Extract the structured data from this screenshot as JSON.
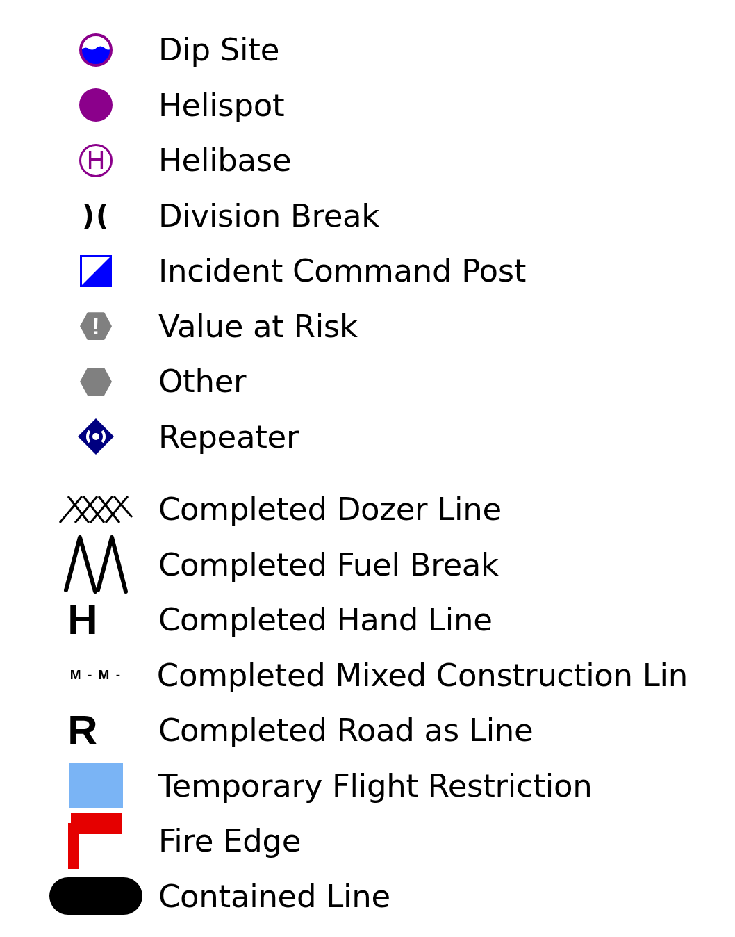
{
  "legend": {
    "groups": [
      {
        "items": [
          {
            "kind": "dip-site",
            "label": "Dip Site"
          },
          {
            "kind": "helispot",
            "label": "Helispot"
          },
          {
            "kind": "helibase",
            "label": "Helibase",
            "symbol": "H"
          },
          {
            "kind": "division-break",
            "label": "Division Break",
            "symbol": ")("
          },
          {
            "kind": "command-post",
            "label": "Incident Command Post"
          },
          {
            "kind": "value-at-risk",
            "label": "Value at Risk",
            "symbol": "!"
          },
          {
            "kind": "other",
            "label": "Other"
          },
          {
            "kind": "repeater",
            "label": "Repeater"
          }
        ]
      },
      {
        "items": [
          {
            "kind": "dozer-line",
            "label": "Completed Dozer Line"
          },
          {
            "kind": "fuel-break",
            "label": "Completed Fuel Break"
          },
          {
            "kind": "letter",
            "label": "Completed Hand Line",
            "symbol": "H"
          },
          {
            "kind": "small-letters",
            "label": "Completed Mixed Construction Lin",
            "symbol": "M - M -"
          },
          {
            "kind": "letter",
            "label": "Completed Road as Line",
            "symbol": "R"
          },
          {
            "kind": "flight-restriction",
            "label": "Temporary Flight Restriction"
          },
          {
            "kind": "fire-edge",
            "label": "Fire Edge"
          },
          {
            "kind": "contained-line",
            "label": "Contained Line"
          }
        ]
      }
    ]
  }
}
